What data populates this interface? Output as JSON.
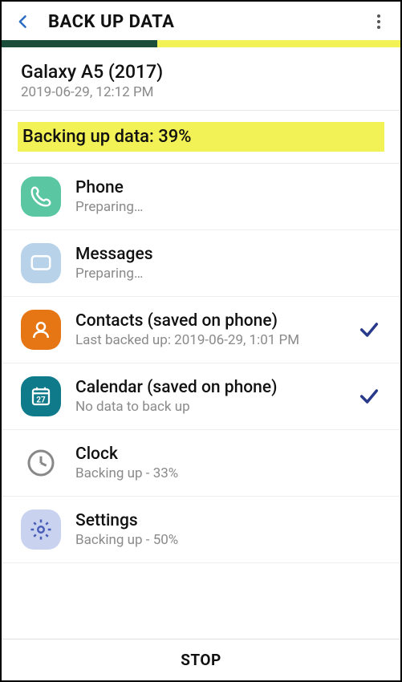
{
  "header": {
    "title": "BACK UP DATA"
  },
  "device": {
    "name": "Galaxy A5 (2017)",
    "timestamp": "2019-06-29, 12:12 PM"
  },
  "status": {
    "label": "Backing up data: 39%",
    "percent": 39
  },
  "items": [
    {
      "icon": "phone-icon",
      "name": "Phone",
      "sub": "Preparing…",
      "done": false
    },
    {
      "icon": "messages-icon",
      "name": "Messages",
      "sub": "Preparing…",
      "done": false
    },
    {
      "icon": "contacts-icon",
      "name": "Contacts (saved on phone)",
      "sub": "Last backed up: 2019-06-29, 1:01 PM",
      "done": true
    },
    {
      "icon": "calendar-icon",
      "name": "Calendar (saved on phone)",
      "sub": "No data to back up",
      "done": true
    },
    {
      "icon": "clock-icon",
      "name": "Clock",
      "sub": "Backing up - 33%",
      "done": false
    },
    {
      "icon": "settings-icon",
      "name": "Settings",
      "sub": "Backing up - 50%",
      "done": false
    }
  ],
  "footer": {
    "stop": "STOP"
  }
}
